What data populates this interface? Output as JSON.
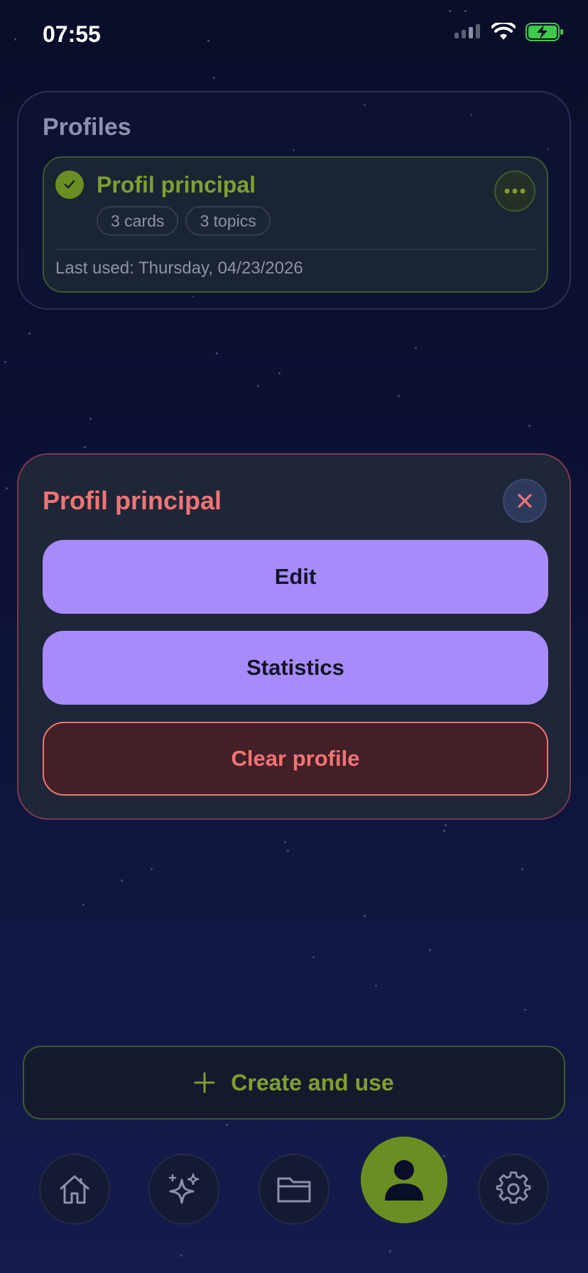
{
  "status_bar": {
    "time": "07:55"
  },
  "profiles": {
    "title": "Profiles",
    "items": [
      {
        "name": "Profil principal",
        "chips": [
          "3 cards",
          "3 topics"
        ],
        "last_used": "Last used: Thursday, 04/23/2026",
        "active": true
      }
    ]
  },
  "modal": {
    "title": "Profil principal",
    "edit_label": "Edit",
    "statistics_label": "Statistics",
    "clear_label": "Clear profile"
  },
  "create_button": {
    "icon": "plus-icon",
    "label": "Create and use"
  },
  "nav": {
    "items": [
      {
        "icon": "home-icon"
      },
      {
        "icon": "sparkles-icon"
      },
      {
        "icon": "folder-icon"
      },
      {
        "icon": "person-icon",
        "active": true
      },
      {
        "icon": "gear-icon"
      }
    ]
  },
  "colors": {
    "accent_green": "#6b8e23",
    "accent_purple": "#a78bfa",
    "danger": "#f27474",
    "background": "#0d1236"
  }
}
